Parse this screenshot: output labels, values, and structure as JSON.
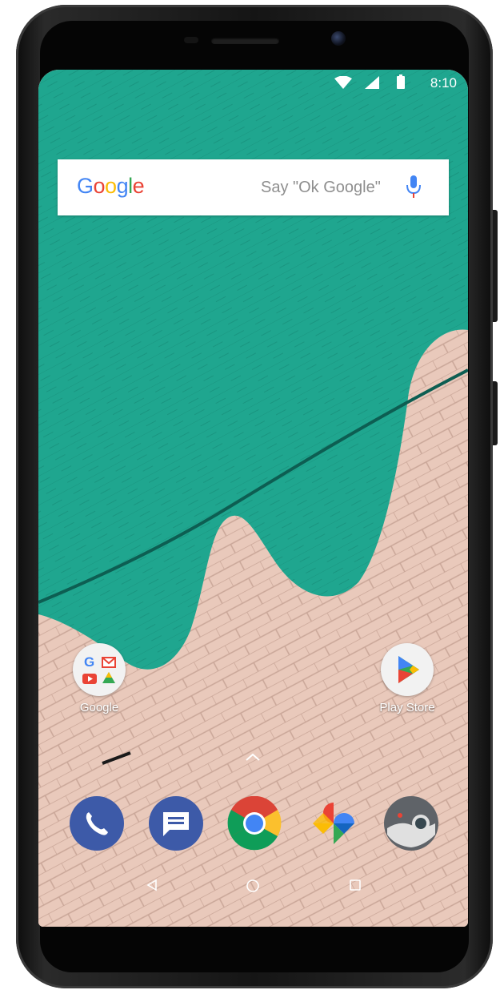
{
  "status_bar": {
    "time": "8:10",
    "icons": [
      "wifi-icon",
      "cell-signal-icon",
      "battery-icon"
    ]
  },
  "search": {
    "logo": "Google",
    "hint": "Say \"Ok Google\"",
    "icon": "mic-icon"
  },
  "home_apps": [
    {
      "label": "Google",
      "icon": "google-folder-icon"
    },
    {
      "label": "Play Store",
      "icon": "play-store-icon"
    }
  ],
  "dock": [
    {
      "name": "Phone",
      "icon": "phone-icon",
      "color": "#3d5aa8"
    },
    {
      "name": "Messages",
      "icon": "messages-icon",
      "color": "#3d5aa8"
    },
    {
      "name": "Chrome",
      "icon": "chrome-icon",
      "color": "#db4437"
    },
    {
      "name": "Photos",
      "icon": "photos-icon",
      "color": "#fbbc05"
    },
    {
      "name": "Camera",
      "icon": "camera-icon",
      "color": "#5f6368"
    }
  ],
  "nav_bar": [
    "back-icon",
    "home-icon",
    "recents-icon"
  ],
  "colors": {
    "wallpaper_teal": "#1ea68e",
    "wallpaper_brick": "#e8c8ba"
  }
}
